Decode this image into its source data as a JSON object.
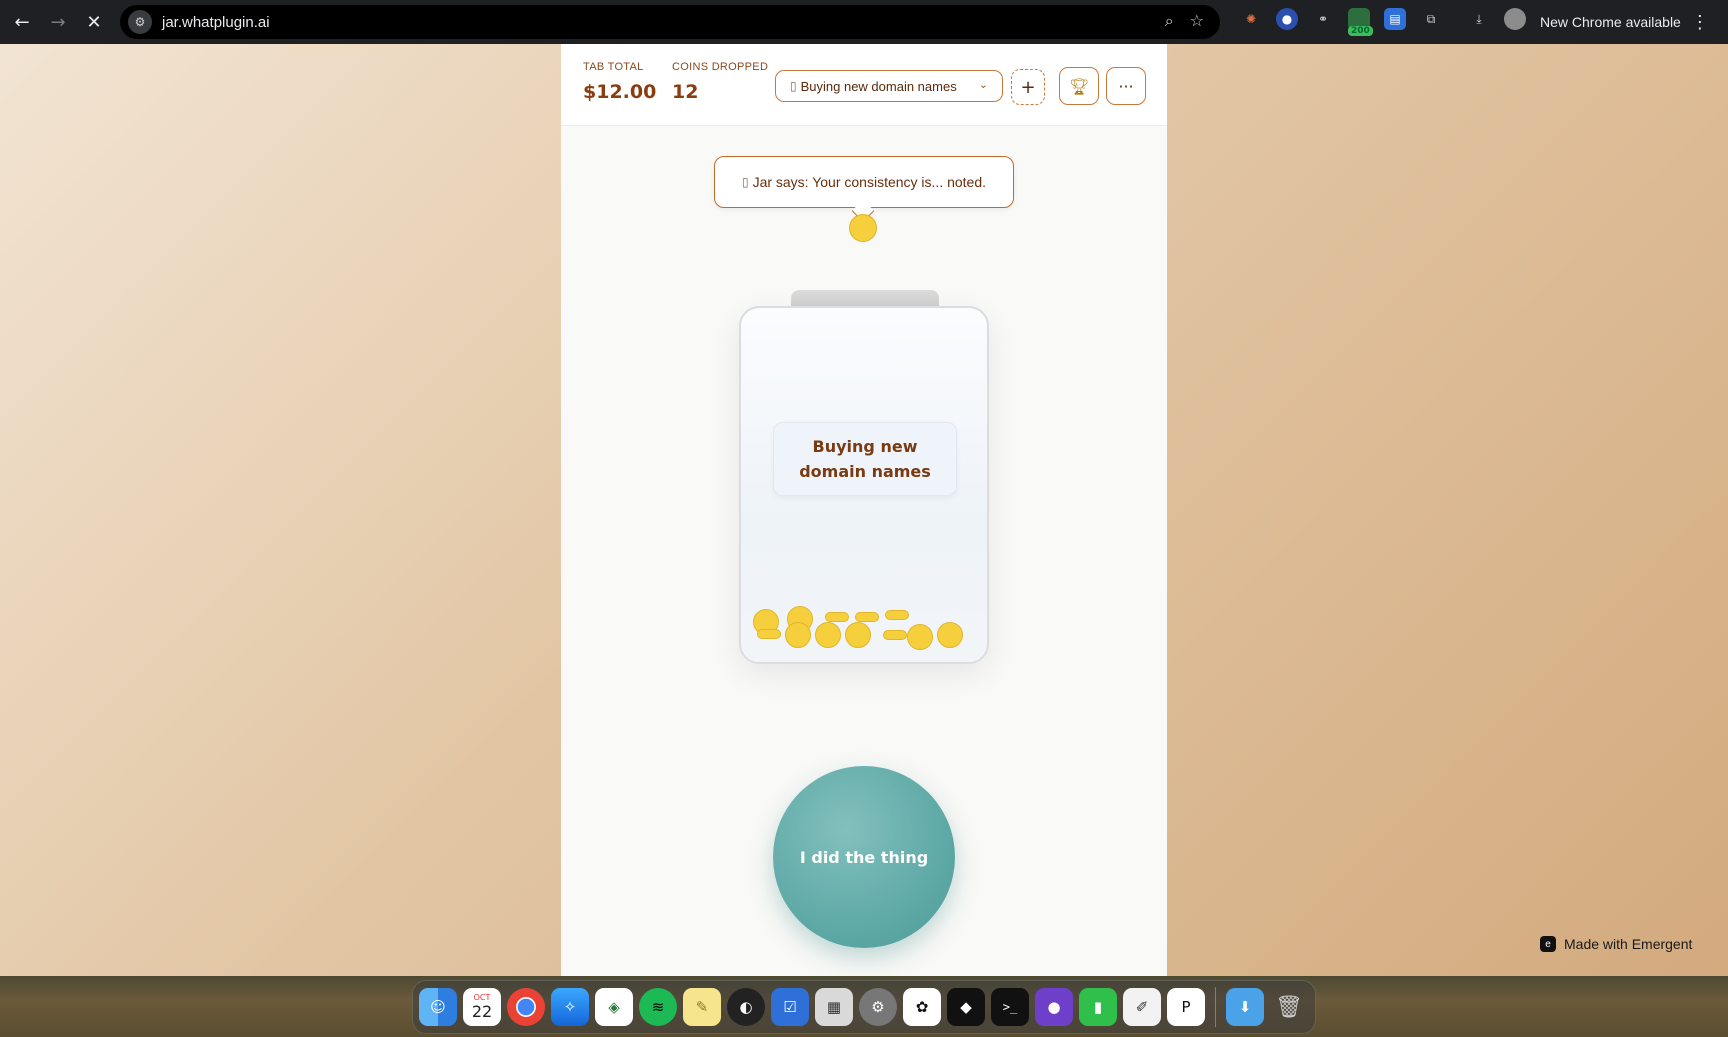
{
  "browser": {
    "url": "jar.whatplugin.ai",
    "new_chrome": "New Chrome available",
    "extension_badge": "200"
  },
  "header": {
    "tab_total_label": "TAB TOTAL",
    "tab_total_value": "$12.00",
    "coins_dropped_label": "COINS DROPPED",
    "coins_dropped_value": "12",
    "jar_select": "Buying new domain names",
    "add_label": "+",
    "more_label": "···"
  },
  "speech": {
    "text": "Jar says: Your consistency is... noted."
  },
  "jar": {
    "label_line1": "Buying new",
    "label_line2": "domain names",
    "coin_count": 12
  },
  "action": {
    "button_label": "I did the thing"
  },
  "footer": {
    "made_with": "Made with Emergent"
  },
  "dock": {
    "calendar_month": "OCT",
    "calendar_day": "22"
  },
  "colors": {
    "accent": "#c9783c",
    "text_brown": "#8a3d10",
    "teal": "#5aa6a3",
    "coin": "#f6cf3c"
  }
}
